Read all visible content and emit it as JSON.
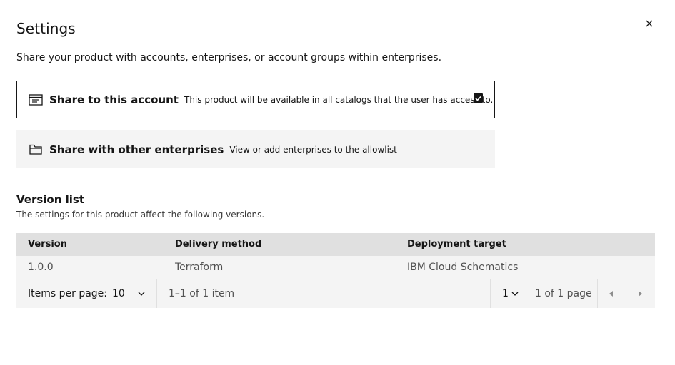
{
  "modal": {
    "title": "Settings",
    "description": "Share your product with accounts, enterprises, or account groups within enterprises."
  },
  "tiles": [
    {
      "title": "Share to this account",
      "description": "This product will be available in all catalogs that the user has access to.",
      "icon": "catalog-icon",
      "checked": true
    },
    {
      "title": "Share with other enterprises",
      "description": "View or add enterprises to the allowlist",
      "icon": "folder-icon",
      "checked": false
    }
  ],
  "version_list": {
    "title": "Version list",
    "description": "The settings for this product affect the following versions.",
    "columns": [
      "Version",
      "Delivery method",
      "Deployment target"
    ],
    "rows": [
      [
        "1.0.0",
        "Terraform",
        "IBM Cloud Schematics"
      ]
    ]
  },
  "pagination": {
    "items_per_page_label": "Items per page:",
    "items_per_page_value": "10",
    "range_text": "1–1 of 1 item",
    "page_value": "1",
    "page_total_text": "1 of 1 page"
  },
  "colors": {
    "text": "#161616",
    "header_bg": "#e0e0e0",
    "row_bg": "#f4f4f4"
  }
}
